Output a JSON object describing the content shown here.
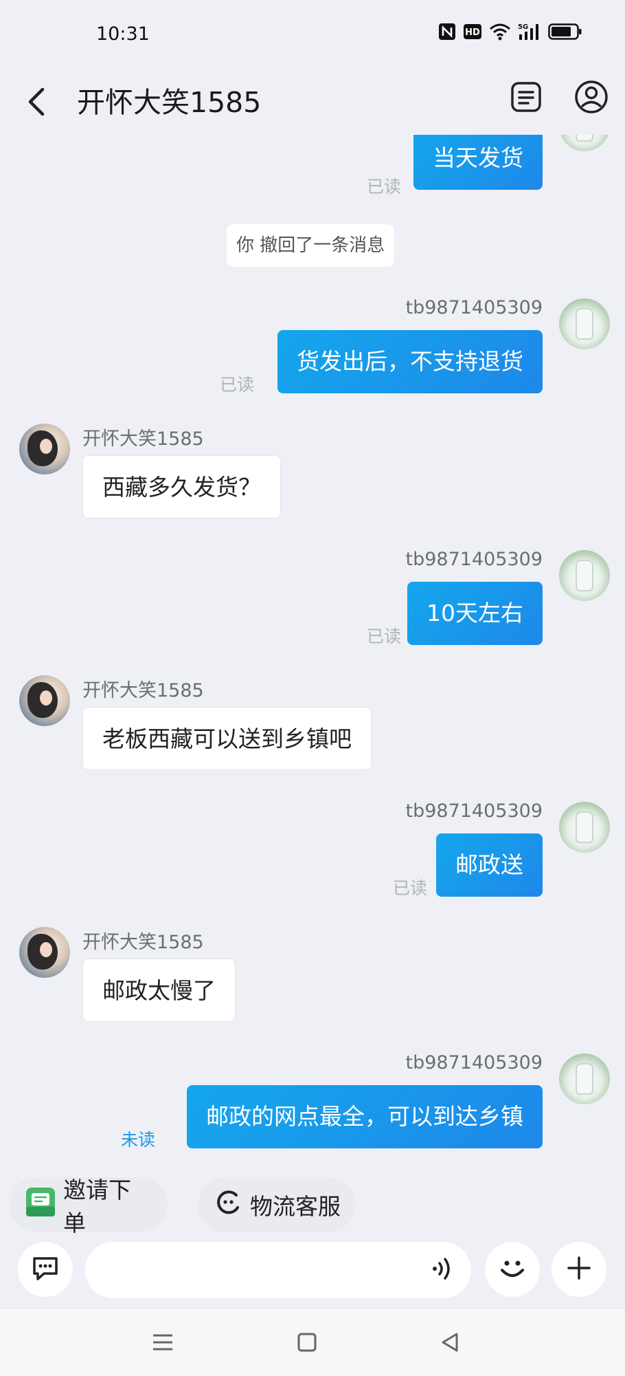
{
  "status_bar": {
    "time": "10:31",
    "network": "5G"
  },
  "header": {
    "title": "开怀大笑1585",
    "back_icon": "chevron-left-icon",
    "orders_icon": "document-list-icon",
    "profile_icon": "user-circle-icon"
  },
  "colors": {
    "accent": "#1a9ae8",
    "outgoing_bubble": "#1e96ea",
    "background": "#eef0f5",
    "unread": "#1a9ae8"
  },
  "messages": [
    {
      "direction": "out",
      "text": "当天发货",
      "status": "已读"
    },
    {
      "type": "system",
      "text": "你 撤回了一条消息"
    },
    {
      "direction": "out",
      "sender": "tb9871405309",
      "text": "货发出后，不支持退货",
      "status": "已读"
    },
    {
      "direction": "in",
      "sender": "开怀大笑1585",
      "text": "西藏多久发货？"
    },
    {
      "direction": "out",
      "sender": "tb9871405309",
      "text": "10天左右",
      "status": "已读"
    },
    {
      "direction": "in",
      "sender": "开怀大笑1585",
      "text": "老板西藏可以送到乡镇吧"
    },
    {
      "direction": "out",
      "sender": "tb9871405309",
      "text": "邮政送",
      "status": "已读"
    },
    {
      "direction": "in",
      "sender": "开怀大笑1585",
      "text": "邮政太慢了"
    },
    {
      "direction": "out",
      "sender": "tb9871405309",
      "text": "邮政的网点最全，可以到达乡镇",
      "status": "未读"
    }
  ],
  "quick_actions": [
    {
      "label": "邀请下单",
      "icon": "invite-order-icon"
    },
    {
      "label": "物流客服",
      "icon": "logistics-service-icon"
    }
  ],
  "input_bar": {
    "input_value": "",
    "chat_mode_icon": "chat-bubble-icon",
    "voice_icon": "voice-wave-icon",
    "emoji_icon": "smile-icon",
    "more_icon": "plus-icon"
  },
  "nav_bar": {
    "icons": [
      "menu-icon",
      "home-square-icon",
      "back-triangle-icon"
    ]
  }
}
